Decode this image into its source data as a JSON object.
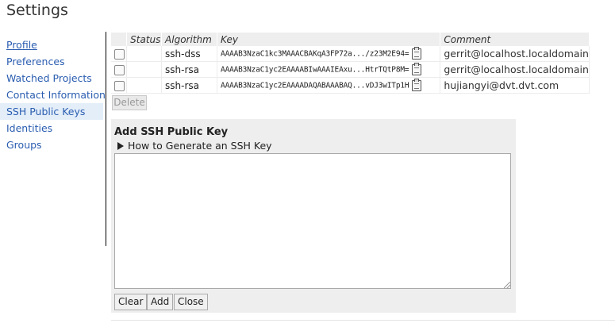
{
  "page_title": "Settings",
  "nav": {
    "items": [
      {
        "label": "Profile"
      },
      {
        "label": "Preferences"
      },
      {
        "label": "Watched Projects"
      },
      {
        "label": "Contact Information"
      },
      {
        "label": "SSH Public Keys",
        "active": true
      },
      {
        "label": "Identities"
      },
      {
        "label": "Groups"
      }
    ]
  },
  "ssh_keys": {
    "columns": {
      "status": "Status",
      "algorithm": "Algorithm",
      "key": "Key",
      "comment": "Comment"
    },
    "rows": [
      {
        "algorithm": "ssh-dss",
        "key": "AAAAB3NzaC1kc3MAAACBAKqA3FP72a.../z23M2E94=",
        "comment": "gerrit@localhost.localdomain"
      },
      {
        "algorithm": "ssh-rsa",
        "key": "AAAAB3NzaC1yc2EAAAABIwAAAIEAxu...HtrTQtP8M=",
        "comment": "gerrit@localhost.localdomain"
      },
      {
        "algorithm": "ssh-rsa",
        "key": "AAAAB3NzaC1yc2EAAAADAQABAAABAQ...vDJ3wITp1H",
        "comment": "hujiangyi@dvt.dvt.com"
      }
    ],
    "delete_label": "Delete"
  },
  "add_key": {
    "title": "Add SSH Public Key",
    "howto_label": "How to Generate an SSH Key",
    "textarea_value": "",
    "clear_label": "Clear",
    "add_label": "Add",
    "close_label": "Close"
  }
}
